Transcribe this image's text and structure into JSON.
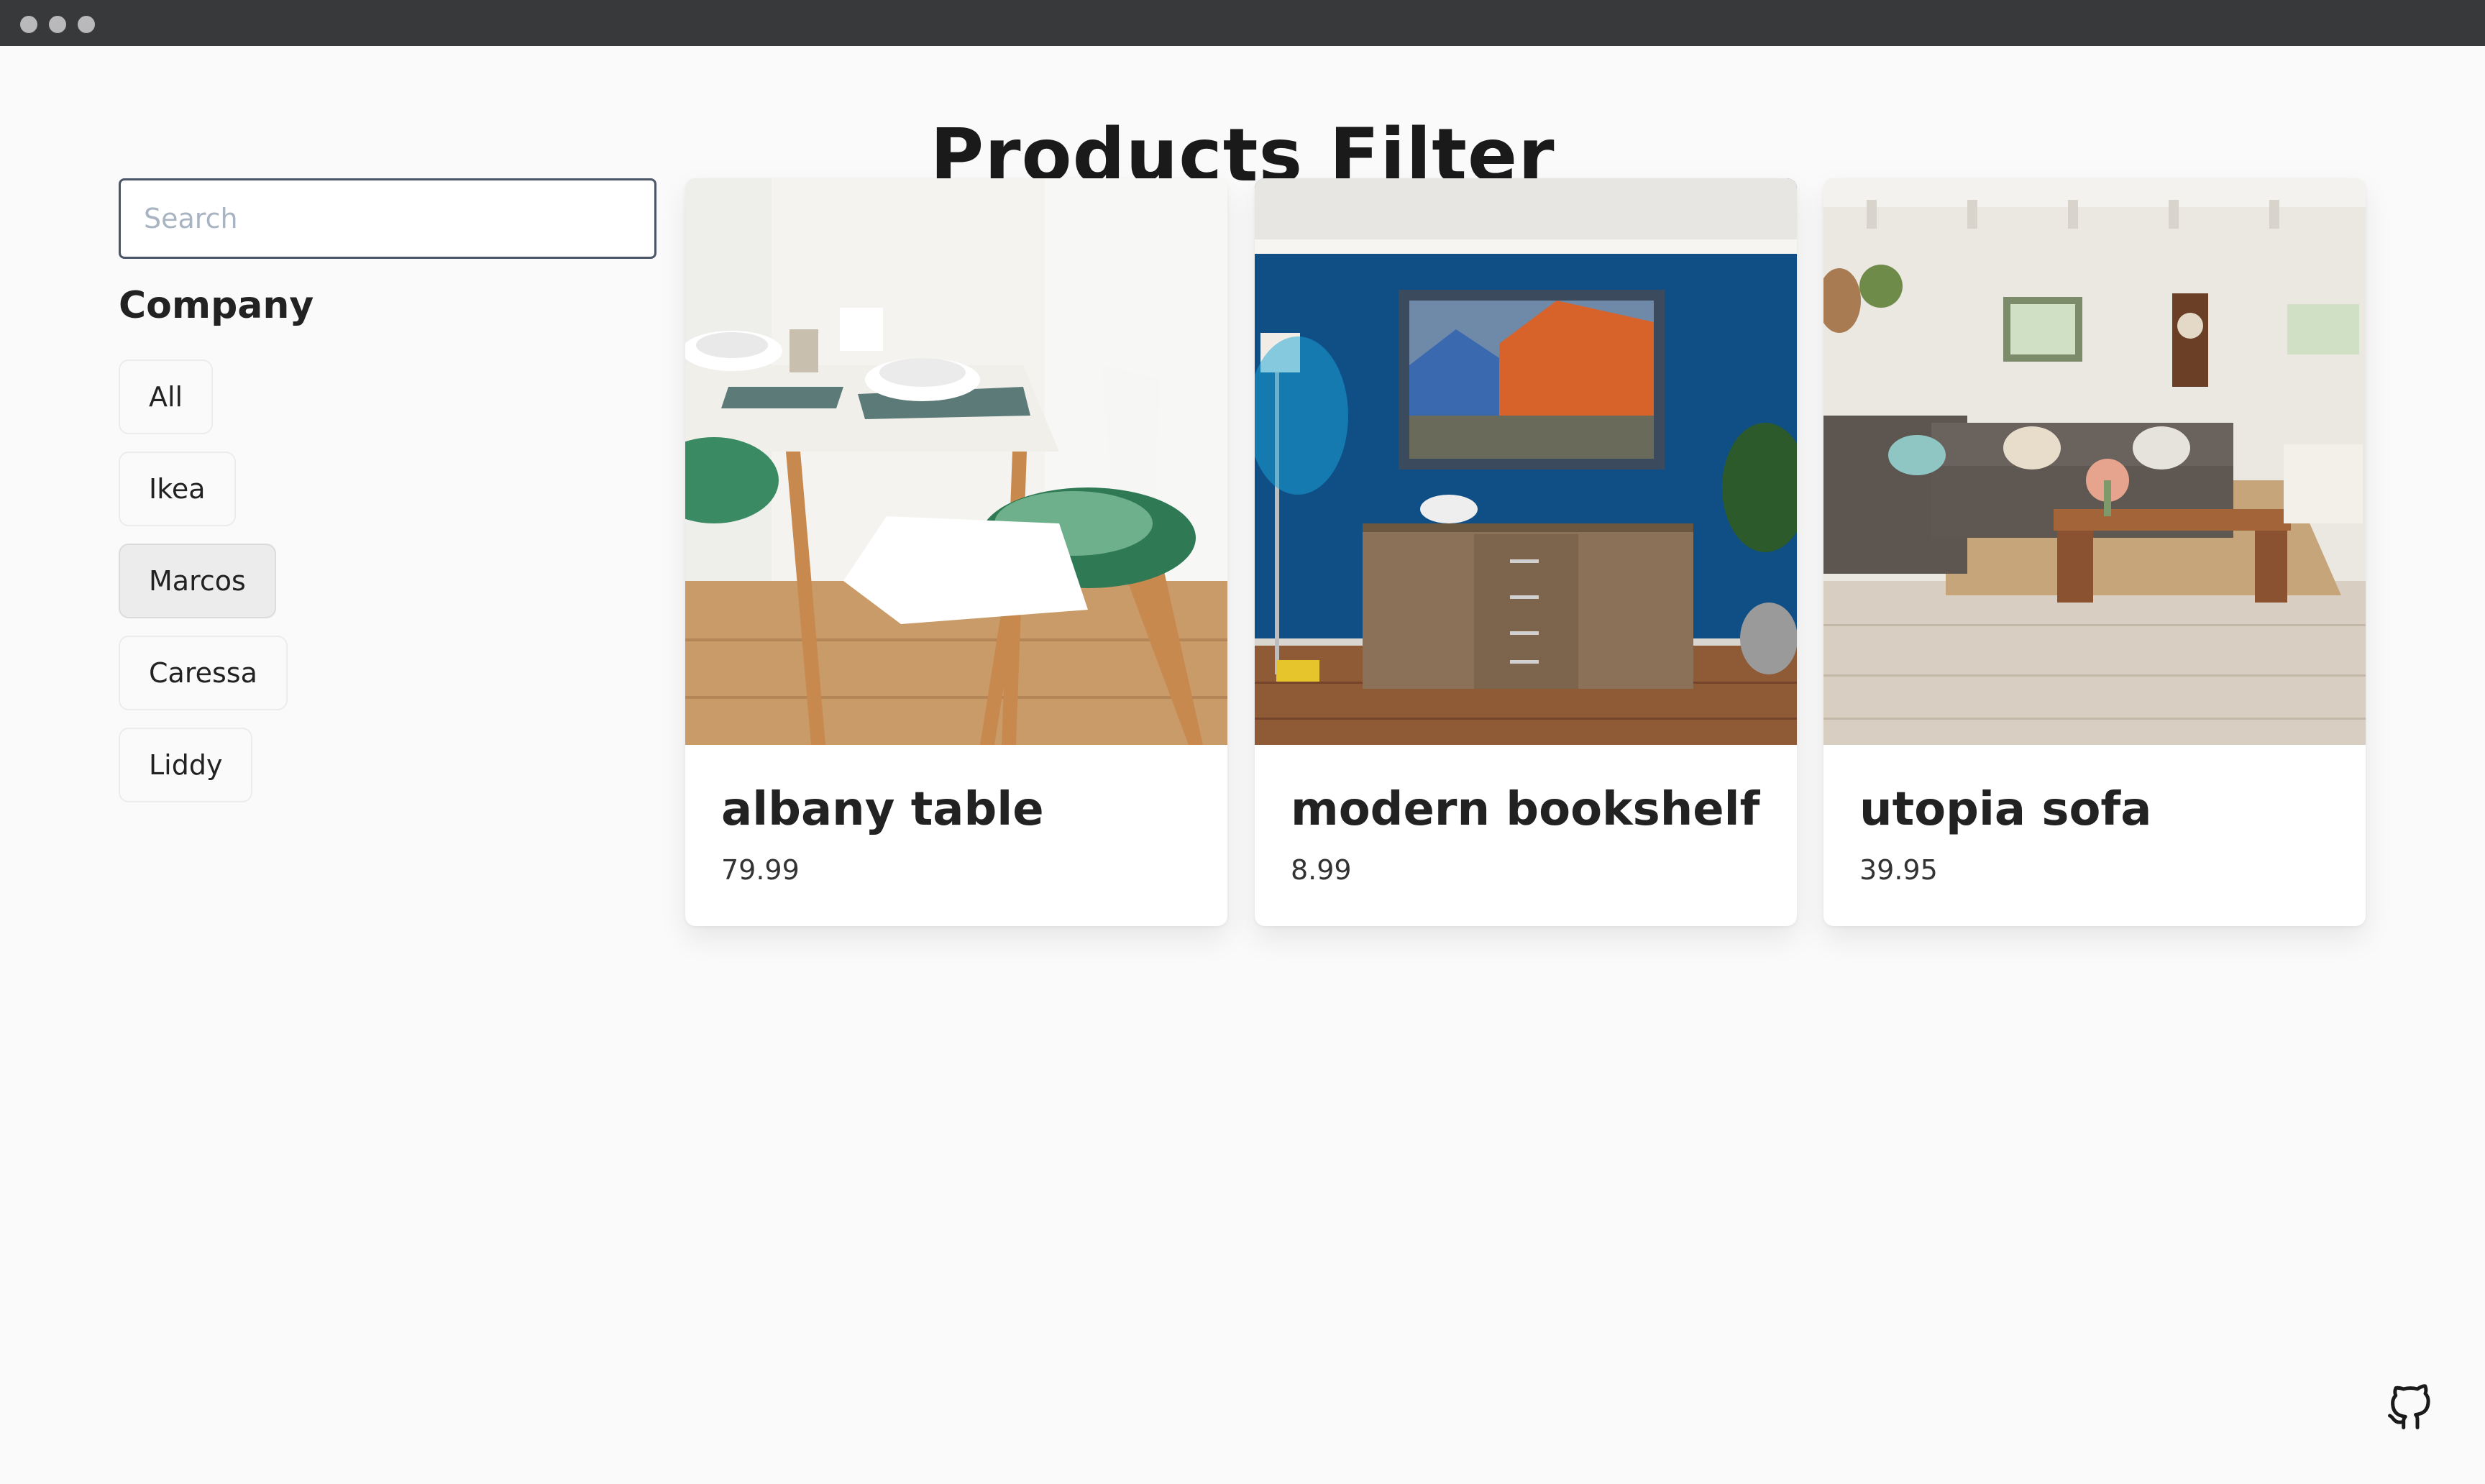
{
  "page": {
    "title": "Products Filter"
  },
  "search": {
    "placeholder": "Search"
  },
  "sidebar": {
    "heading": "Company",
    "companies": [
      {
        "label": "All",
        "active": false
      },
      {
        "label": "Ikea",
        "active": false
      },
      {
        "label": "Marcos",
        "active": true
      },
      {
        "label": "Caressa",
        "active": false
      },
      {
        "label": "Liddy",
        "active": false
      }
    ]
  },
  "products": [
    {
      "name": "albany table",
      "price": "79.99",
      "image": "dining-table-photo"
    },
    {
      "name": "modern bookshelf",
      "price": "8.99",
      "image": "blue-wall-sideboard-photo"
    },
    {
      "name": "utopia sofa",
      "price": "39.95",
      "image": "living-room-sofa-photo"
    }
  ],
  "footer": {
    "icon": "github-icon"
  },
  "colors": {
    "background": "#fafafa",
    "titlebar": "#38393b",
    "active_filter": "#ececec",
    "search_border": "#4a5568"
  }
}
